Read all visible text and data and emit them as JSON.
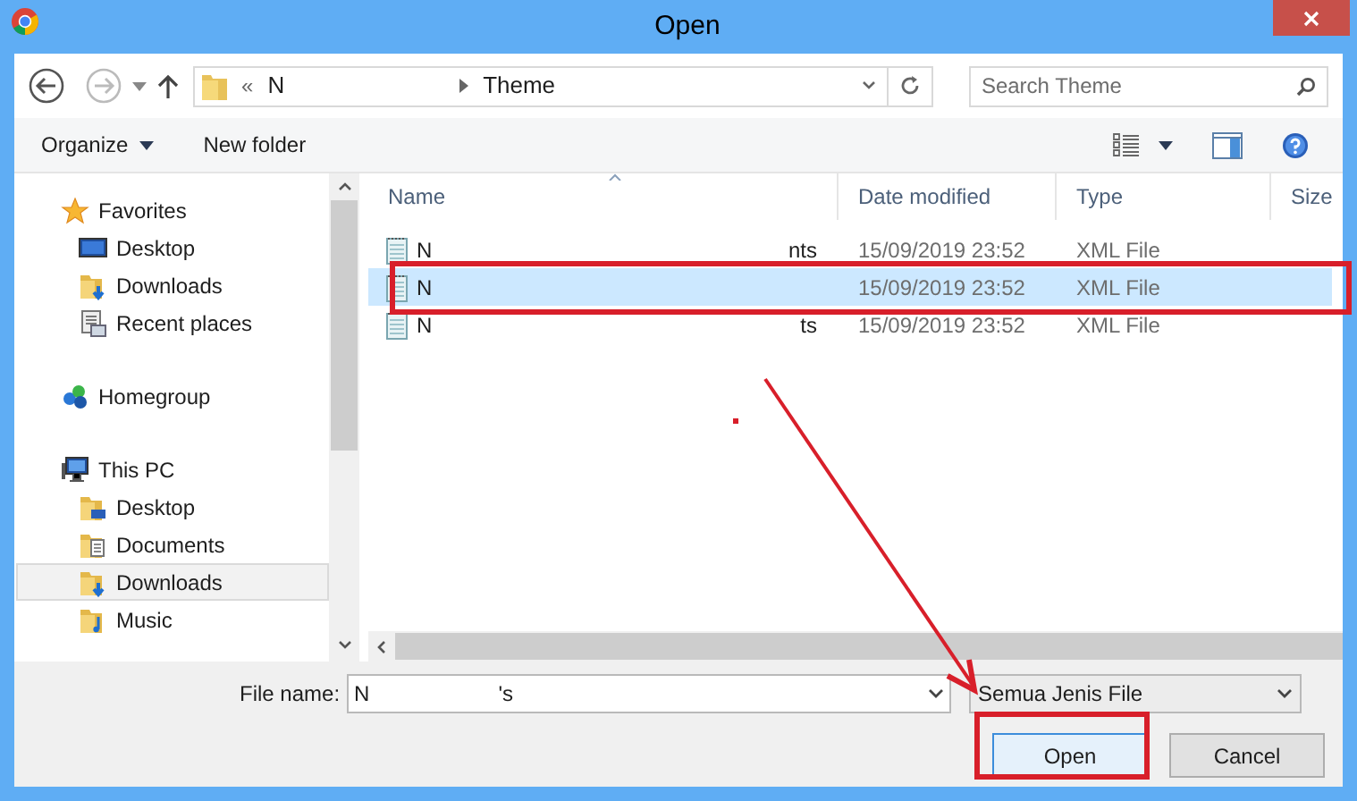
{
  "window": {
    "title": "Open"
  },
  "nav": {
    "breadcrumb": [
      {
        "text": "«"
      },
      {
        "text": "N"
      },
      {
        "text": "Theme"
      }
    ],
    "search": {
      "placeholder": "Search Theme"
    }
  },
  "toolbar": {
    "organize": "Organize",
    "new_folder": "New folder"
  },
  "sidebar": {
    "groups": [
      {
        "label": "Favorites",
        "kind": "star",
        "items": [
          {
            "label": "Desktop",
            "kind": "desktop",
            "selected": false
          },
          {
            "label": "Downloads",
            "kind": "downloads",
            "selected": false
          },
          {
            "label": "Recent places",
            "kind": "recent",
            "selected": false
          }
        ]
      },
      {
        "label": "Homegroup",
        "kind": "homegroup"
      },
      {
        "label": "This PC",
        "kind": "pc",
        "items": [
          {
            "label": "Desktop",
            "kind": "desktop-folder",
            "selected": false
          },
          {
            "label": "Documents",
            "kind": "documents",
            "selected": false
          },
          {
            "label": "Downloads",
            "kind": "downloads",
            "selected": true
          },
          {
            "label": "Music",
            "kind": "music",
            "selected": false
          }
        ]
      }
    ]
  },
  "table": {
    "columns": [
      "Name",
      "Date modified",
      "Type",
      "Size"
    ],
    "rows": [
      {
        "name": "N",
        "name_end": "nts",
        "date": "15/09/2019 23:52",
        "type": "XML File",
        "selected": false
      },
      {
        "name": "N",
        "date": "15/09/2019 23:52",
        "type": "XML File",
        "selected": true
      },
      {
        "name": "N",
        "name_end": "ts",
        "date": "15/09/2019 23:52",
        "type": "XML File",
        "selected": false
      }
    ]
  },
  "footer": {
    "file_name_label": "File name:",
    "file_name": "N",
    "file_name_end": "'s",
    "filter": "Semua Jenis File",
    "buttons": [
      {
        "label": "Open",
        "default": true
      },
      {
        "label": "Cancel",
        "default": false
      }
    ]
  }
}
